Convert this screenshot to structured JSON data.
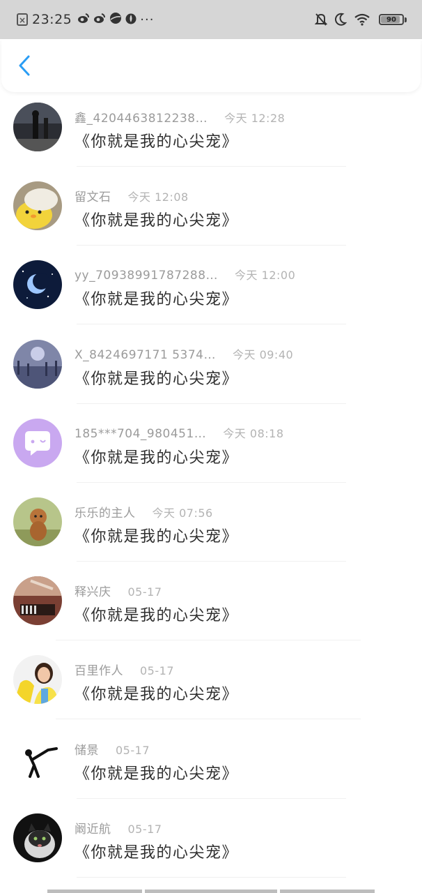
{
  "status_bar": {
    "time": "23:25",
    "battery": "90",
    "battery_level": 0.9,
    "left_icons": [
      "close-box-icon",
      "weibo-icon",
      "weibo-icon",
      "planet-icon",
      "flame-icon"
    ],
    "right_icons": [
      "bell-off-icon",
      "moon-icon",
      "wifi-icon",
      "battery-icon"
    ],
    "more": "···"
  },
  "header": {
    "back_icon": "chevron-left-icon",
    "accent_color": "#2a9df4"
  },
  "messages": [
    {
      "user": "鑫_4204463812238…",
      "time": "今天 12:28",
      "text": "《你就是我的心尖宠》",
      "avatar": "concert-stage-avatar"
    },
    {
      "user": "留文石",
      "time": "今天 12:08",
      "text": "《你就是我的心尖宠》",
      "avatar": "chick-avatar"
    },
    {
      "user": "yy_70938991787288…",
      "time": "今天 12:00",
      "text": "《你就是我的心尖宠》",
      "avatar": "moon-night-avatar"
    },
    {
      "user": "X_8424697171 5374…",
      "time": "今天 09:40",
      "text": "《你就是我的心尖宠》",
      "avatar": "crowd-avatar"
    },
    {
      "user": "185***704_980451…",
      "time": "今天 08:18",
      "text": "《你就是我的心尖宠》",
      "avatar": "default-chat-avatar"
    },
    {
      "user": "乐乐的主人",
      "time": "今天 07:56",
      "text": "《你就是我的心尖宠》",
      "avatar": "dog-avatar"
    },
    {
      "user": "释兴庆",
      "time": "05-17",
      "text": "《你就是我的心尖宠》",
      "avatar": "piano-avatar"
    },
    {
      "user": "百里作人",
      "time": "05-17",
      "text": "《你就是我的心尖宠》",
      "avatar": "girl-avatar"
    },
    {
      "user": "储景",
      "time": "05-17",
      "text": "《你就是我的心尖宠》",
      "avatar": "stick-figure-avatar"
    },
    {
      "user": "阚近航",
      "time": "05-17",
      "text": "《你就是我的心尖宠》",
      "avatar": "cat-avatar"
    }
  ]
}
